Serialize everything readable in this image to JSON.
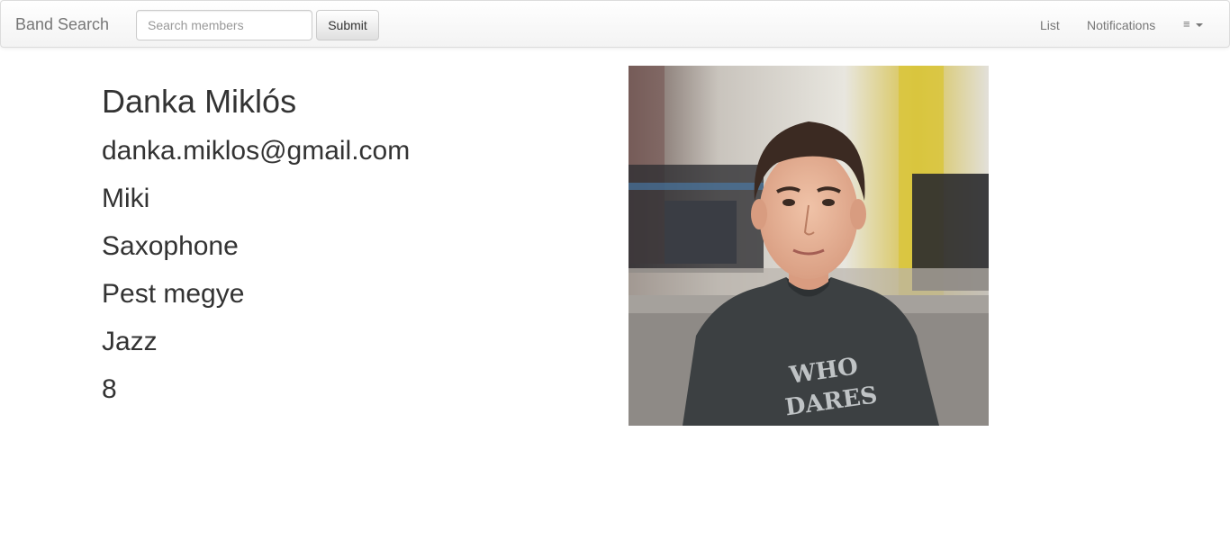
{
  "navbar": {
    "brand": "Band Search",
    "search": {
      "placeholder": "Search members",
      "value": ""
    },
    "submit_label": "Submit",
    "links": {
      "list": "List",
      "notifications": "Notifications"
    },
    "menu_icon": "hamburger-icon",
    "menu_glyph": "≡"
  },
  "profile": {
    "name": "Danka Miklós",
    "email": "danka.miklos@gmail.com",
    "nickname": "Miki",
    "instrument": "Saxophone",
    "county": "Pest megye",
    "genre": "Jazz",
    "number": "8"
  },
  "colors": {
    "navbar_text": "#777777",
    "body_text": "#333333"
  }
}
